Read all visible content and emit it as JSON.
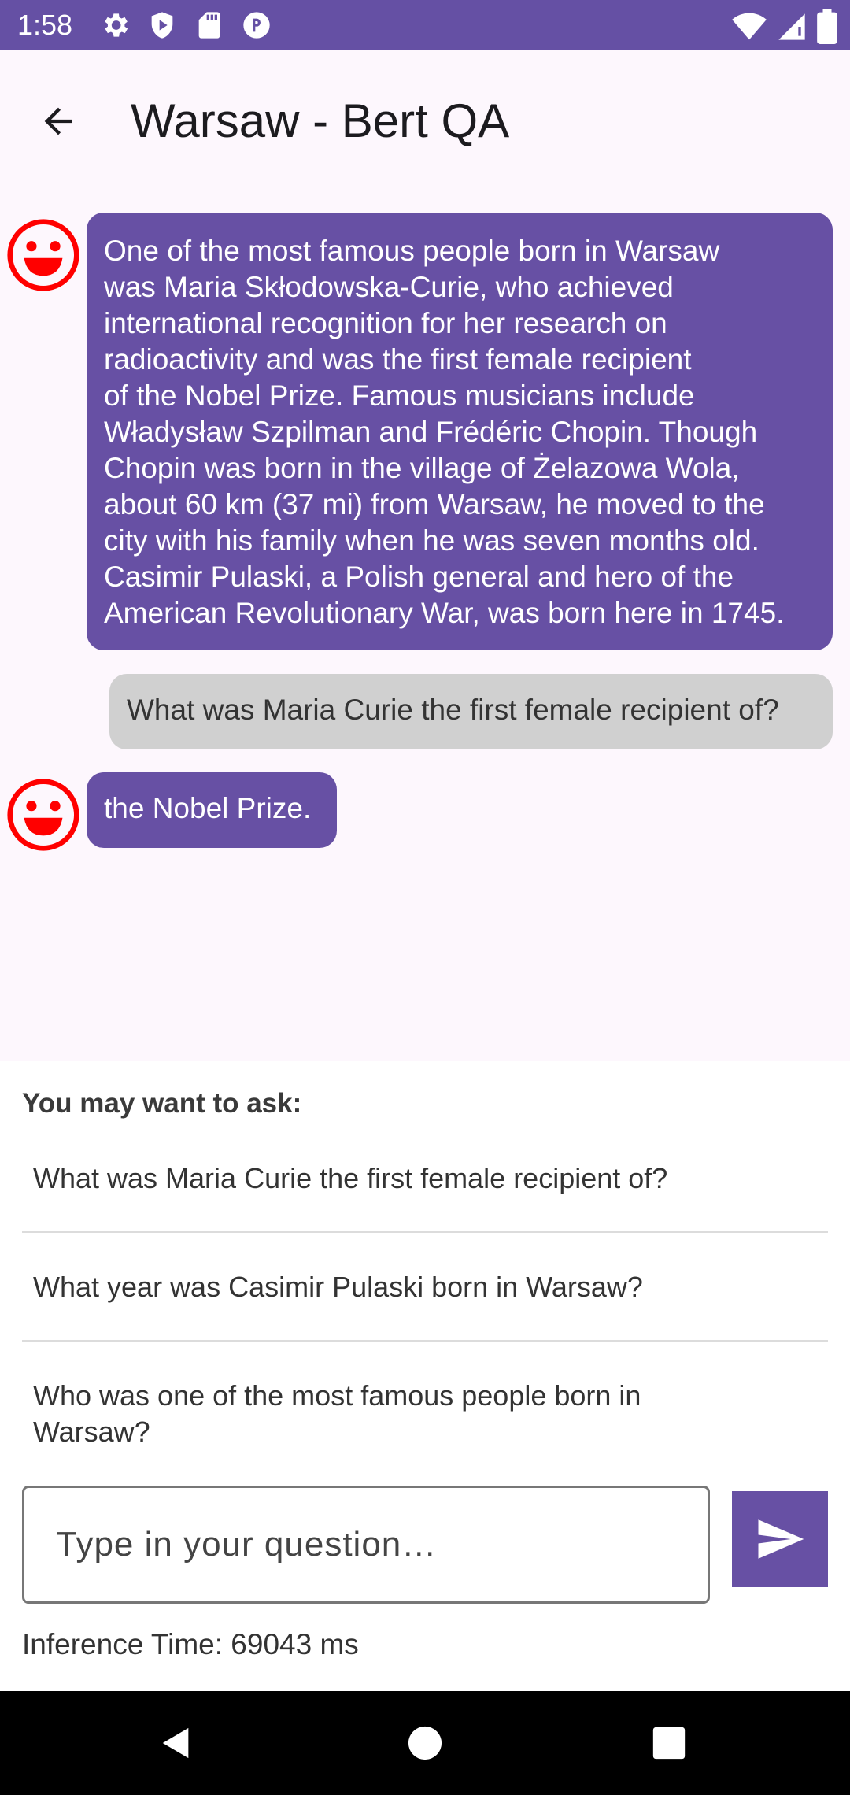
{
  "status_bar": {
    "time": "1:58",
    "left_icons": [
      "gear-icon",
      "shield-play-icon",
      "sd-card-icon",
      "vpn-key-icon"
    ],
    "right_icons": [
      "wifi-icon",
      "signal-icon",
      "battery-icon"
    ]
  },
  "app_bar": {
    "back_icon": "arrow-back-icon",
    "title": "Warsaw - Bert QA"
  },
  "chat": {
    "messages": [
      {
        "sender": "bot",
        "avatar_icon": "smiley-face-icon",
        "lines": [
          "One of the most famous people born in Warsaw",
          "was Maria Skłodowska-Curie, who achieved",
          "international recognition for her research on",
          "radioactivity and was the first female recipient",
          "of the Nobel Prize. Famous musicians include",
          "Władysław Szpilman and Frédéric Chopin. Though",
          "Chopin was born in the village of Żelazowa Wola,",
          "about 60 km (37 mi) from Warsaw, he moved to the",
          "city with his family when he was seven months old.",
          "Casimir Pulaski, a Polish general and hero of the",
          "American Revolutionary War, was born here in 1745."
        ]
      },
      {
        "sender": "user",
        "text": "What was Maria Curie the first female recipient of?"
      },
      {
        "sender": "bot",
        "avatar_icon": "smiley-face-icon",
        "text": "the Nobel Prize."
      }
    ]
  },
  "suggestions": {
    "header": "You may want to ask:",
    "items": [
      "What was Maria Curie the first female recipient of?",
      "What year was Casimir Pulaski born in Warsaw?",
      "Who was one of the most famous people born in Warsaw?"
    ]
  },
  "input": {
    "placeholder": "Type in your question…",
    "value": ""
  },
  "send_button": {
    "icon": "send-icon"
  },
  "inference": {
    "text": "Inference Time: 69043 ms"
  },
  "nav_bar": {
    "icons": [
      "nav-back-icon",
      "nav-home-icon",
      "nav-recents-icon"
    ]
  },
  "colors": {
    "status_bar": "#6550a4",
    "accent": "#6750a4",
    "user_bubble": "#d0d0d0",
    "avatar": "#ff0000",
    "background": "#fdf7fd"
  }
}
